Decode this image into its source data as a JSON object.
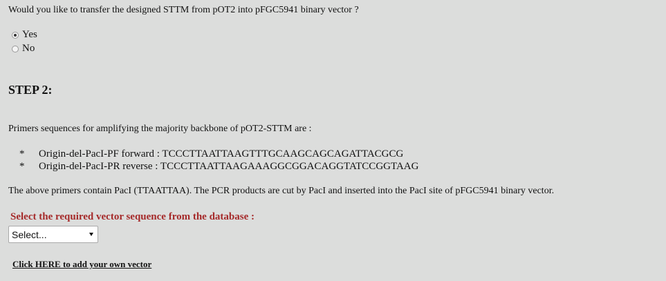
{
  "transfer": {
    "question": "Would you like to transfer the designed STTM from pOT2 into pFGC5941 binary vector ?",
    "options": [
      {
        "label": "Yes",
        "checked": true
      },
      {
        "label": "No",
        "checked": false
      }
    ]
  },
  "step": {
    "title": "STEP 2:"
  },
  "primers": {
    "intro": "Primers sequences for amplifying the majority backbone of pOT2-STTM are :",
    "bullet": "*",
    "items": [
      {
        "text": "Origin-del-PacI-PF forward : TCCCTTAATTAAGTTTGCAAGCAGCAGATTACGCG"
      },
      {
        "text": "Origin-del-PacI-PR reverse : TCCCTTAATTAAGAAAGGCGGACAGGTATCCGGTAAG"
      }
    ],
    "note": "The above primers contain PacI (TTAATTAA). The PCR products are cut by PacI and inserted into the PacI site of pFGC5941 binary vector."
  },
  "vector": {
    "label": "Select the required vector sequence from the database :",
    "selected": "Select...",
    "label_color": "#a52a2a"
  },
  "own_vector": {
    "link": "Click HERE to add your own vector"
  }
}
